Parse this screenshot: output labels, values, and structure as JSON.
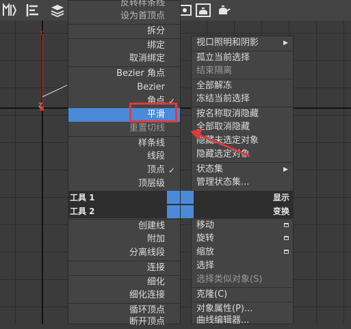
{
  "colors": {
    "highlight": "#4b8ad8",
    "annotation": "#e03a3a",
    "menu_bg": "#444444",
    "quad_header_bg": "#2d2d2d"
  },
  "toolbar": {
    "icons": [
      "editable-mesh-icon",
      "align-icon",
      "layers-icon",
      "render-setup-icon",
      "render-frame-icon",
      "render-icon"
    ]
  },
  "viewport": {
    "axis_y_label": "Y",
    "axis_z_label": "Z"
  },
  "left_menu": {
    "items": [
      {
        "label": "反转样条线"
      },
      {
        "label": "设为首顶点"
      },
      {
        "label": "拆分"
      },
      {
        "label": "绑定"
      },
      {
        "label": "取消绑定"
      },
      {
        "label": "Bezier 角点"
      },
      {
        "label": "Bezier"
      },
      {
        "label": "角点",
        "checked": "✓"
      },
      {
        "label": "平滑"
      },
      {
        "label": "重置切线"
      },
      {
        "label": "样条线"
      },
      {
        "label": "线段"
      },
      {
        "label": "顶点",
        "checked": "✓"
      },
      {
        "label": "顶层级"
      },
      {
        "label": "创建线"
      },
      {
        "label": "附加"
      },
      {
        "label": "分离线段"
      },
      {
        "label": "连接"
      },
      {
        "label": "细化"
      },
      {
        "label": "细化连接"
      },
      {
        "label": "循环顶点"
      },
      {
        "label": "断开顶点"
      }
    ]
  },
  "quad_headers": {
    "tools1": "工具 1",
    "tools2": "工具 2",
    "display": "显示",
    "transform": "变换"
  },
  "right_menu": {
    "items": [
      {
        "label": "视口照明和阴影",
        "arrow": "▶"
      },
      {
        "label": "孤立当前选择"
      },
      {
        "label": "结束隔离"
      },
      {
        "label": "全部解冻"
      },
      {
        "label": "冻结当前选择"
      },
      {
        "label": "按名称取消隐藏"
      },
      {
        "label": "全部取消隐藏"
      },
      {
        "label": "隐藏未选定对象"
      },
      {
        "label": "隐藏选定对象"
      },
      {
        "label": "状态集",
        "arrow": "▶"
      },
      {
        "label": "管理状态集..."
      },
      {
        "label": "移动"
      },
      {
        "label": "旋转"
      },
      {
        "label": "缩放"
      },
      {
        "label": "选择"
      },
      {
        "label": "选择类似对象(S)"
      },
      {
        "label": "克隆(C)"
      },
      {
        "label": "对象属性(P)..."
      },
      {
        "label": "曲线编辑器..."
      }
    ]
  }
}
